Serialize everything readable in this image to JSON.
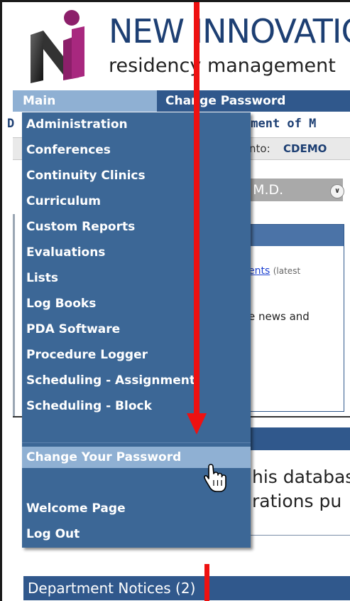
{
  "header": {
    "brand_title": "NEW INNOVATIONS",
    "brand_subtitle": "residency management"
  },
  "nav": {
    "main_label": "Main",
    "change_password_label": "Change Password"
  },
  "background": {
    "dept_prefix": "D",
    "dept_text": "tment of M",
    "context_label": "nto:",
    "context_org": "CDEMO",
    "user_name": "u M.D.",
    "news_link": "ents",
    "news_link_suffix": "(latest",
    "news_text": "e news and",
    "body_line1": "his databas",
    "body_line2": "rations pu",
    "dept_notices": "Department Notices (2)"
  },
  "menu": {
    "items": [
      "Administration",
      "Conferences",
      "Continuity Clinics",
      "Curriculum",
      "Custom Reports",
      "Evaluations",
      "Lists",
      "Log Books",
      "PDA Software",
      "Procedure Logger",
      "Scheduling - Assignment",
      "Scheduling - Block"
    ],
    "change_password": "Change Your Password",
    "welcome": "Welcome Page",
    "logout": "Log Out"
  },
  "icons": {
    "logo": "ni-logo",
    "chevron": "chevron-down-circle-icon",
    "cursor": "hand-pointer-icon",
    "arrow": "red-arrow-annotation"
  },
  "colors": {
    "nav_blue": "#30588c",
    "menu_blue": "#3c6796",
    "highlight": "#8fb0d3",
    "annotation_red": "#ee1111"
  }
}
